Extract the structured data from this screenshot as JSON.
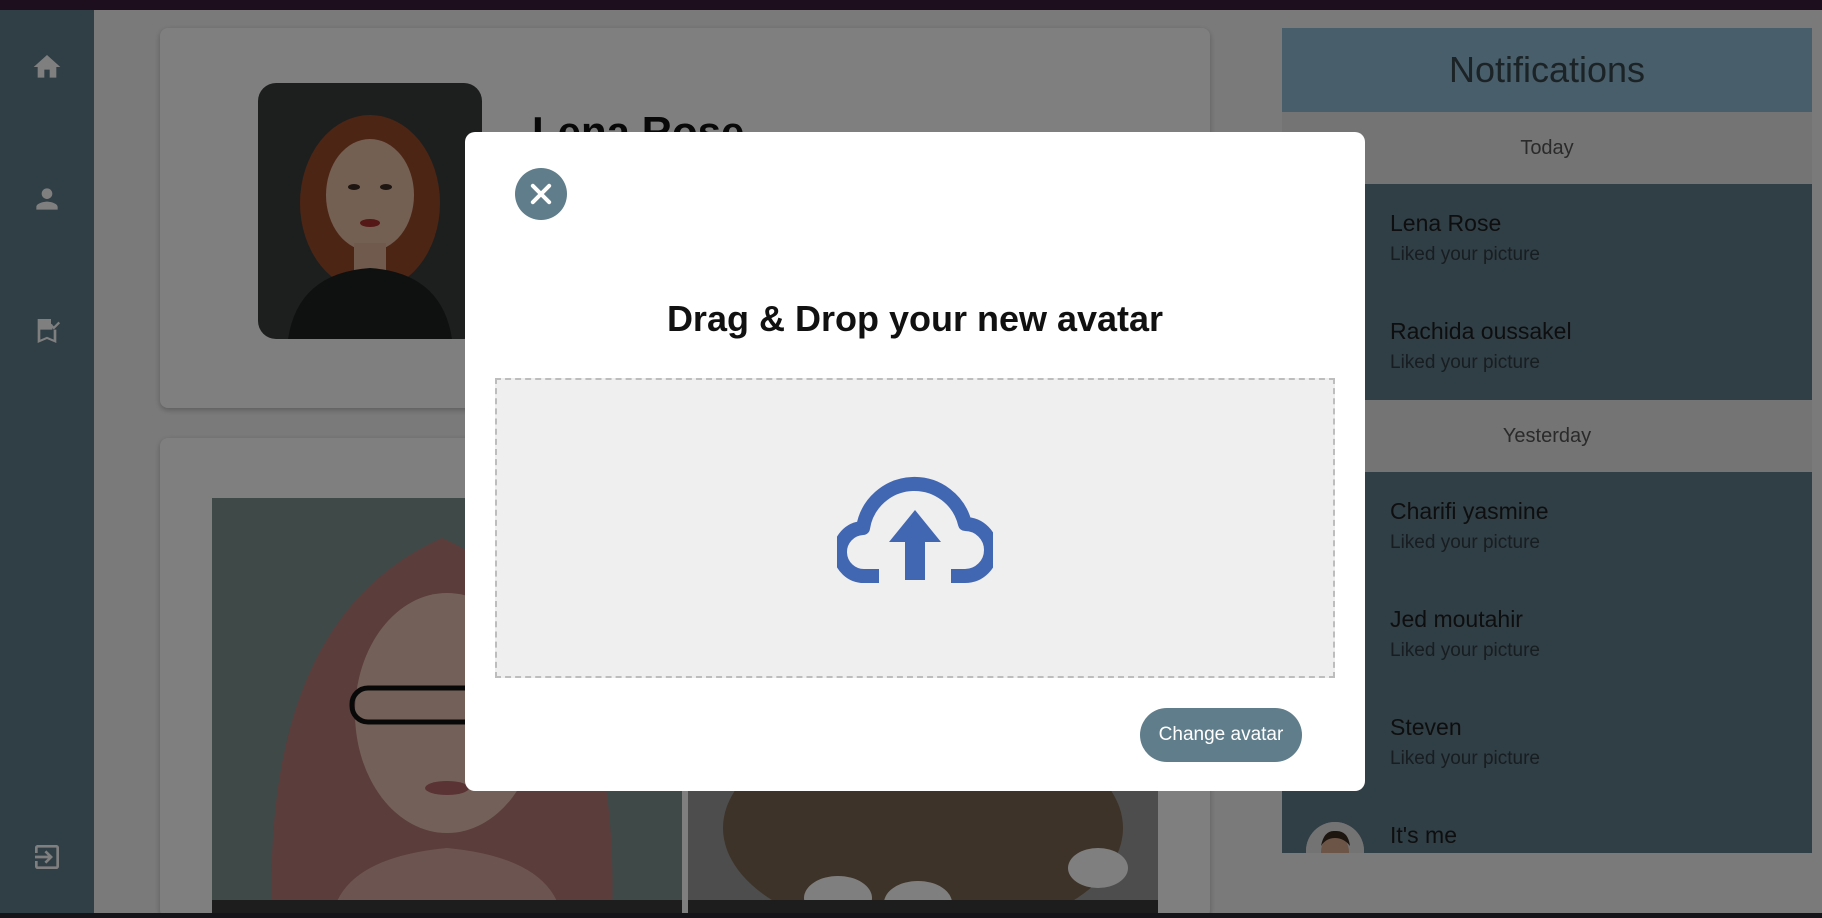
{
  "profile": {
    "name": "Lena Rose"
  },
  "notifications": {
    "title": "Notifications",
    "groups": [
      {
        "label": "Today",
        "items": [
          {
            "name": "Lena Rose",
            "action": "Liked your picture"
          },
          {
            "name": "Rachida oussakel",
            "action": "Liked your picture"
          }
        ]
      },
      {
        "label": "Yesterday",
        "items": [
          {
            "name": "Charifi yasmine",
            "action": "Liked your picture"
          },
          {
            "name": "Jed moutahir",
            "action": "Liked your picture"
          },
          {
            "name": "Steven",
            "action": "Liked your picture"
          },
          {
            "name": "It's me",
            "action": ""
          }
        ]
      }
    ]
  },
  "modal": {
    "title": "Drag & Drop your new avatar",
    "submit_label": "Change avatar"
  },
  "colors": {
    "accent": "#607d8b",
    "upload_icon": "#4267b2",
    "notif_header": "#90bcd4"
  },
  "icons": {
    "nav": [
      "home-icon",
      "person-icon",
      "bookmark-check-icon",
      "logout-icon"
    ],
    "close": "close-icon",
    "upload": "cloud-upload-icon"
  }
}
